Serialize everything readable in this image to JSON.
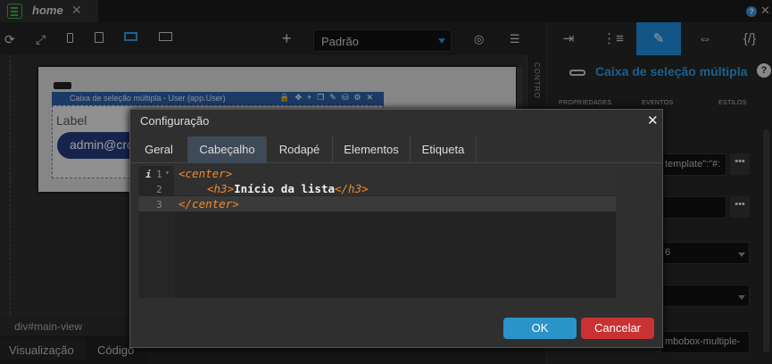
{
  "tabs": {
    "home_label": "home",
    "close": "✕"
  },
  "topbar": {
    "help": "?",
    "close": "✕"
  },
  "toolbar": {
    "icons": [
      "refresh-icon",
      "expand-icon",
      "mobile-icon",
      "tablet-icon",
      "desktop-icon",
      "monitor-icon",
      "add-icon",
      "visibility-icon",
      "database-icon"
    ],
    "add": "+",
    "select_value": "Padrão"
  },
  "canvas": {
    "component_title": "Caixa de seleção múltipla - User (app.User)",
    "component_label": "Label",
    "component_value": "admin@cro",
    "controls_text": "CONTRO"
  },
  "bottom": {
    "breadcrumb": "div#main-view",
    "tab_visualizacao": "Visualização",
    "tab_codigo": "Código"
  },
  "right_panel": {
    "title": "Caixa de seleção múltipla",
    "help": "?",
    "sub_tabs": [
      "PROPRIEDADES",
      "EVENTOS",
      "ESTILOS"
    ],
    "field1": "template\":\"#:",
    "field2": "",
    "field3": "6",
    "field4": "",
    "field5": "mbobox-multiple-",
    "dots": "•••"
  },
  "dialog": {
    "title": "Configuração",
    "close": "✕",
    "tabs": [
      "Geral",
      "Cabeçalho",
      "Rodapé",
      "Elementos",
      "Etiqueta"
    ],
    "active_tab": "Cabeçalho",
    "line_numbers": [
      "1",
      "2",
      "3"
    ],
    "info_marker": "i",
    "code": {
      "l1_tag": "<center>",
      "l2_open": "<h3>",
      "l2_text": "Início da lista",
      "l2_close": "</h3>",
      "l3_tag": "</center>"
    },
    "ok": "OK",
    "cancel": "Cancelar"
  },
  "colors": {
    "accent": "#1f8ad8",
    "ok": "#2a93c8",
    "cancel": "#c83232",
    "code_tag": "#f38a2a",
    "component_bar": "#2d5fa5"
  }
}
